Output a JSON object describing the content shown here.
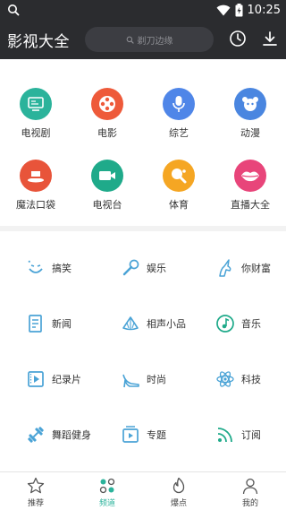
{
  "status_bar": {
    "time": "10:25",
    "icons": [
      "search-icon",
      "wifi-icon",
      "battery-icon"
    ]
  },
  "header": {
    "title": "影视大全",
    "search_placeholder": "剃刀边缘"
  },
  "categories": [
    {
      "label": "电视剧",
      "icon": "tv-icon",
      "color": "#2bb39b"
    },
    {
      "label": "电影",
      "icon": "film-reel-icon",
      "color": "#ee5a3a"
    },
    {
      "label": "综艺",
      "icon": "microphone-icon",
      "color": "#4f86e8"
    },
    {
      "label": "动漫",
      "icon": "cartoon-icon",
      "color": "#4a86e0"
    },
    {
      "label": "魔法口袋",
      "icon": "magic-hat-icon",
      "color": "#e8543a"
    },
    {
      "label": "电视台",
      "icon": "camera-icon",
      "color": "#1faa8a"
    },
    {
      "label": "体育",
      "icon": "ping-pong-icon",
      "color": "#f5a623"
    },
    {
      "label": "直播大全",
      "icon": "lips-icon",
      "color": "#e8457a"
    }
  ],
  "channels": [
    {
      "label": "搞笑",
      "icon": "funny-face-icon"
    },
    {
      "label": "娱乐",
      "icon": "microphone-icon"
    },
    {
      "label": "你财富",
      "icon": "unicorn-icon"
    },
    {
      "label": "新闻",
      "icon": "news-icon"
    },
    {
      "label": "相声小品",
      "icon": "fan-icon"
    },
    {
      "label": "音乐",
      "icon": "music-icon"
    },
    {
      "label": "纪录片",
      "icon": "documentary-icon"
    },
    {
      "label": "时尚",
      "icon": "high-heel-icon"
    },
    {
      "label": "科技",
      "icon": "atom-icon"
    },
    {
      "label": "舞蹈健身",
      "icon": "dumbbell-icon"
    },
    {
      "label": "专题",
      "icon": "topic-icon"
    },
    {
      "label": "订阅",
      "icon": "rss-icon"
    }
  ],
  "tabs": [
    {
      "label": "推荐",
      "icon": "star-icon"
    },
    {
      "label": "频道",
      "icon": "grid-dots-icon"
    },
    {
      "label": "爆点",
      "icon": "flame-icon"
    },
    {
      "label": "我的",
      "icon": "person-icon"
    }
  ],
  "colors": {
    "header_bg": "#2b2c2f",
    "channel_icon": "#4aa3d6",
    "page_bg": "#f2f2f2"
  }
}
